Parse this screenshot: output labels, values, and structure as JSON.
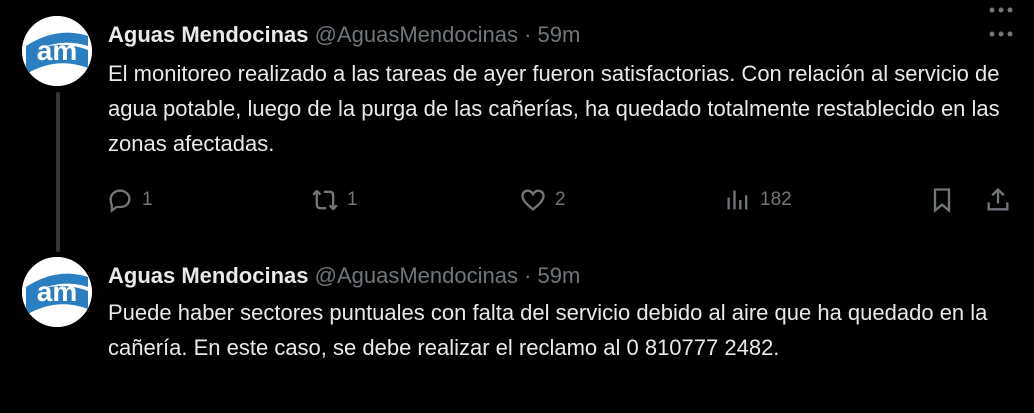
{
  "tweets": [
    {
      "author_name": "Aguas Mendocinas",
      "author_handle": "@AguasMendocinas",
      "separator": "·",
      "time": "59m",
      "avatar_text": "am",
      "text": "El monitoreo realizado a las tareas de ayer fueron satisfactorias. Con relación al servicio de agua potable, luego de la purga de las cañerías, ha quedado totalmente restablecido en las zonas afectadas.",
      "replies": "1",
      "retweets": "1",
      "likes": "2",
      "views": "182"
    },
    {
      "author_name": "Aguas Mendocinas",
      "author_handle": "@AguasMendocinas",
      "separator": "·",
      "time": "59m",
      "avatar_text": "am",
      "text": "Puede haber sectores puntuales con falta del servicio debido al aire que ha quedado en la cañería. En este caso, se debe realizar el reclamo al 0 810777 2482."
    }
  ],
  "colors": {
    "background": "#000000",
    "text": "#e7e9ea",
    "secondary": "#71767b",
    "thread_line": "#333639",
    "avatar_blue": "#2b7fc1"
  },
  "icons": [
    "reply-icon",
    "retweet-icon",
    "like-icon",
    "views-icon",
    "bookmark-icon",
    "share-icon",
    "more-icon"
  ]
}
